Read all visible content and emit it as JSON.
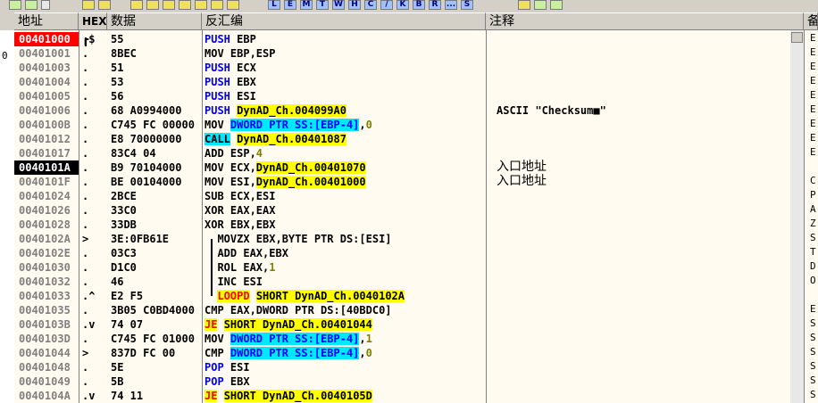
{
  "headers": {
    "addr": "地址",
    "hex": "HEX",
    "data": "数据",
    "disasm": "反汇编",
    "comment": "注释",
    "extra": "备"
  },
  "toolbar": {
    "letters": [
      "L",
      "E",
      "M",
      "T",
      "W",
      "H",
      "C",
      "/",
      "K",
      "B",
      "R",
      "...",
      "S"
    ]
  },
  "left_strip_char": "0",
  "rows": [
    {
      "addr": "00401000",
      "mark": "┏$",
      "hex": "55",
      "mnem": "PUSH",
      "ops": "EBP",
      "cmt": "",
      "addr_style": "sel-red"
    },
    {
      "addr": "00401001",
      "mark": ".",
      "hex": "8BEC",
      "mnem": "MOV",
      "ops": "EBP,ESP",
      "cmt": ""
    },
    {
      "addr": "00401003",
      "mark": ".",
      "hex": "51",
      "mnem": "PUSH",
      "ops": "ECX",
      "cmt": ""
    },
    {
      "addr": "00401004",
      "mark": ".",
      "hex": "53",
      "mnem": "PUSH",
      "ops": "EBX",
      "cmt": ""
    },
    {
      "addr": "00401005",
      "mark": ".",
      "hex": "56",
      "mnem": "PUSH",
      "ops": "ESI",
      "cmt": ""
    },
    {
      "addr": "00401006",
      "mark": ".",
      "hex": "68 A0994000",
      "mnem": "PUSH",
      "ops": "DynAD_Ch.004099A0",
      "cmt": "ASCII \"Checksum■\""
    },
    {
      "addr": "0040100B",
      "mark": ".",
      "hex": "C745 FC 00000",
      "mnem": "MOV",
      "ops": "DWORD PTR SS:[EBP-4],0",
      "cmt": ""
    },
    {
      "addr": "00401012",
      "mark": ".",
      "hex": "E8 70000000",
      "mnem": "CALL",
      "ops": "DynAD_Ch.00401087",
      "cmt": ""
    },
    {
      "addr": "00401017",
      "mark": ".",
      "hex": "83C4 04",
      "mnem": "ADD",
      "ops": "ESP,4",
      "cmt": ""
    },
    {
      "addr": "0040101A",
      "mark": ".",
      "hex": "B9 70104000",
      "mnem": "MOV",
      "ops": "ECX,DynAD_Ch.00401070",
      "cmt": "入口地址",
      "addr_style": "sel-black"
    },
    {
      "addr": "0040101F",
      "mark": ".",
      "hex": "BE 00104000",
      "mnem": "MOV",
      "ops": "ESI,DynAD_Ch.00401000",
      "cmt": "入口地址"
    },
    {
      "addr": "00401024",
      "mark": ".",
      "hex": "2BCE",
      "mnem": "SUB",
      "ops": "ECX,ESI",
      "cmt": ""
    },
    {
      "addr": "00401026",
      "mark": ".",
      "hex": "33C0",
      "mnem": "XOR",
      "ops": "EAX,EAX",
      "cmt": ""
    },
    {
      "addr": "00401028",
      "mark": ".",
      "hex": "33DB",
      "mnem": "XOR",
      "ops": "EBX,EBX",
      "cmt": ""
    },
    {
      "addr": "0040102A",
      "mark": ">",
      "hex": "3E:0FB61E",
      "mnem": "MOVZX",
      "ops": "EBX,BYTE PTR DS:[ESI]",
      "cmt": ""
    },
    {
      "addr": "0040102E",
      "mark": ".",
      "hex": "03C3",
      "mnem": "ADD",
      "ops": "EAX,EBX",
      "cmt": ""
    },
    {
      "addr": "00401030",
      "mark": ".",
      "hex": "D1C0",
      "mnem": "ROL",
      "ops": "EAX,1",
      "cmt": ""
    },
    {
      "addr": "00401032",
      "mark": ".",
      "hex": "46",
      "mnem": "INC",
      "ops": "ESI",
      "cmt": ""
    },
    {
      "addr": "00401033",
      "mark": ".^",
      "hex": "E2 F5",
      "mnem": "LOOPD",
      "ops": "SHORT DynAD_Ch.0040102A",
      "cmt": ""
    },
    {
      "addr": "00401035",
      "mark": ".",
      "hex": "3B05 C0BD4000",
      "mnem": "CMP",
      "ops": "EAX,DWORD PTR DS:[40BDC0]",
      "cmt": ""
    },
    {
      "addr": "0040103B",
      "mark": ".v",
      "hex": "74 07",
      "mnem": "JE",
      "ops": "SHORT DynAD_Ch.00401044",
      "cmt": ""
    },
    {
      "addr": "0040103D",
      "mark": ".",
      "hex": "C745 FC 01000",
      "mnem": "MOV",
      "ops": "DWORD PTR SS:[EBP-4],1",
      "cmt": ""
    },
    {
      "addr": "00401044",
      "mark": ">",
      "hex": "837D FC 00",
      "mnem": "CMP",
      "ops": "DWORD PTR SS:[EBP-4],0",
      "cmt": ""
    },
    {
      "addr": "00401048",
      "mark": ".",
      "hex": "5E",
      "mnem": "POP",
      "ops": "ESI",
      "cmt": ""
    },
    {
      "addr": "00401049",
      "mark": ".",
      "hex": "5B",
      "mnem": "POP",
      "ops": "EBX",
      "cmt": ""
    },
    {
      "addr": "0040104A",
      "mark": ".v",
      "hex": "74 11",
      "mnem": "JE",
      "ops": "SHORT DynAD_Ch.0040105D",
      "cmt": ""
    }
  ],
  "right_strip_letters": [
    "E",
    "E",
    "E",
    "E",
    "E",
    "E",
    "E",
    "E",
    "E",
    "",
    "C",
    "P",
    "A",
    "Z",
    "S",
    "T",
    "D",
    "O",
    "",
    "E",
    "S",
    "S",
    "S",
    "S",
    "S",
    "S"
  ]
}
